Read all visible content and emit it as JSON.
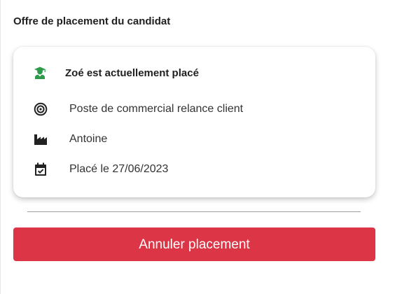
{
  "section": {
    "title": "Offre de placement du candidat"
  },
  "card": {
    "status": "Zoé est actuellement placé",
    "job": "Poste de commercial relance client",
    "company": "Antoine",
    "date": "Placé le 27/06/2023"
  },
  "icons": {
    "status": "graduate-person-icon",
    "job": "target-icon",
    "company": "factory-icon",
    "date": "calendar-check-icon"
  },
  "colors": {
    "status_icon": "#2e9a4a",
    "danger": "#dc3545"
  },
  "actions": {
    "cancel_label": "Annuler placement"
  }
}
